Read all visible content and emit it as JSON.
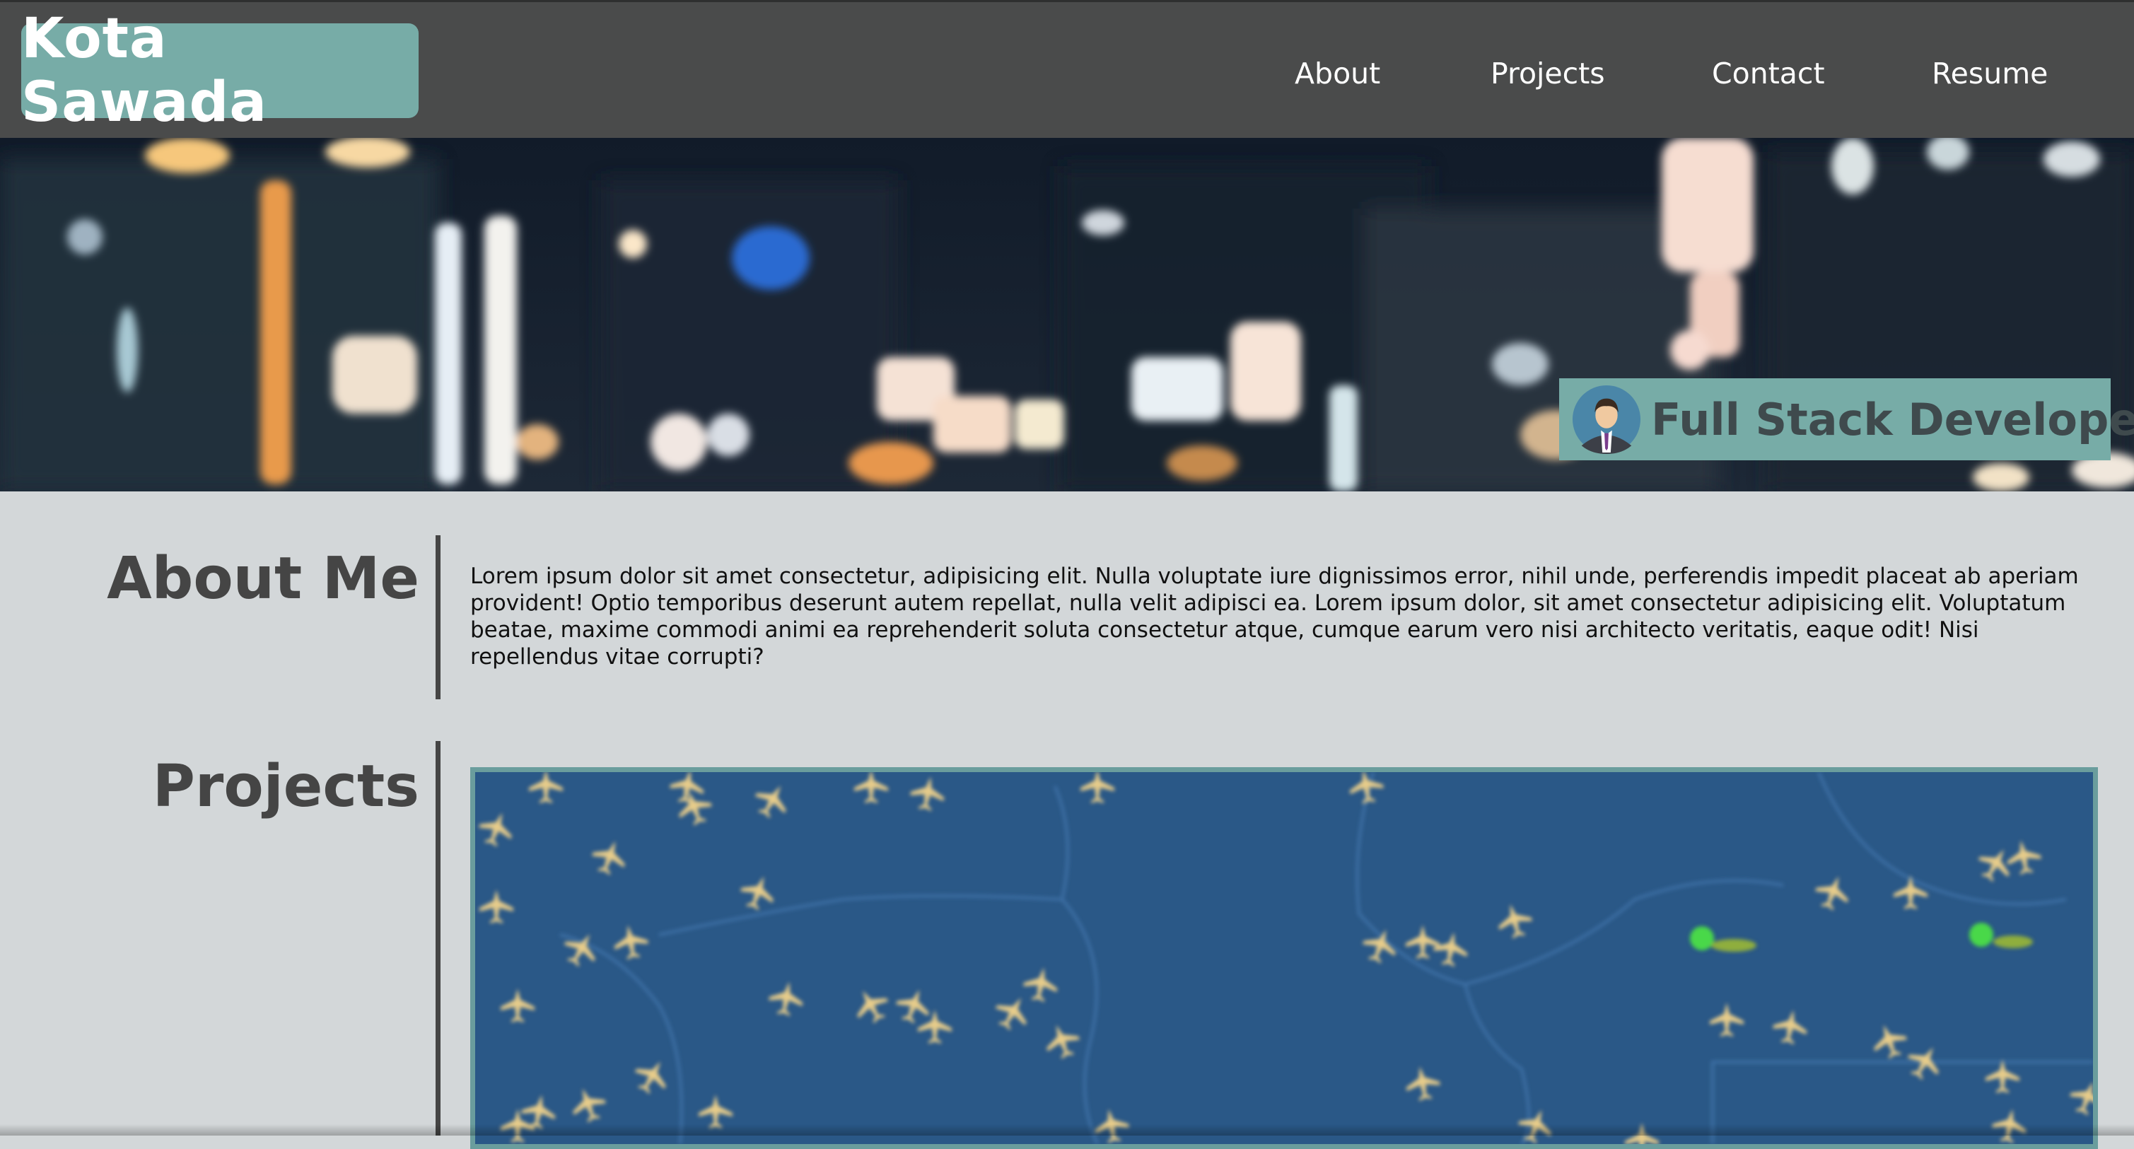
{
  "nav": {
    "brand": "Kota Sawada",
    "links": [
      {
        "label": "About"
      },
      {
        "label": "Projects"
      },
      {
        "label": "Contact"
      },
      {
        "label": "Resume"
      }
    ]
  },
  "hero": {
    "tagline": "Full Stack Developer",
    "avatar_icon": "developer-avatar-icon"
  },
  "about": {
    "title": "About Me",
    "text": "Lorem ipsum dolor sit amet consectetur, adipisicing elit. Nulla voluptate iure dignissimos error, nihil unde, perferendis impedit placeat ab aperiam provident! Optio temporibus deserunt autem repellat, nulla velit adipisci ea. Lorem ipsum dolor, sit amet consectetur adipisicing elit. Voluptatum beatae, maxime commodi animi ea reprehenderit soluta consectetur atque, cumque earum vero nisi architecto veritatis, eaque odit! Nisi repellendus vitae corrupti?"
  },
  "projects": {
    "title": "Projects",
    "preview_icon": "flight-map-screenshot"
  },
  "colors": {
    "navbar": "#4a4b4b",
    "accent": "#77aca7",
    "page_bg": "#d3d7d9",
    "heading": "#454545",
    "map_bg": "#2a5887"
  }
}
